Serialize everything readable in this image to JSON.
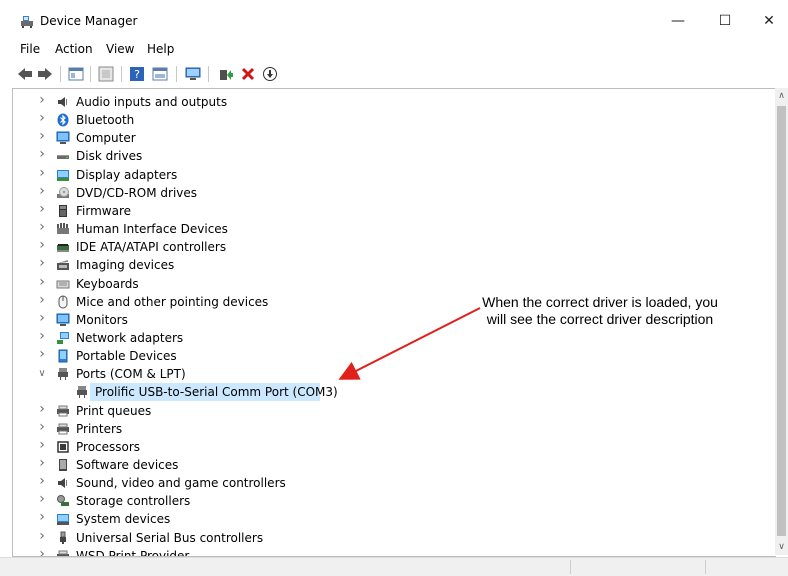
{
  "window": {
    "title": "Device Manager",
    "minimize_glyph": "—",
    "maximize_glyph": "☐",
    "close_glyph": "✕"
  },
  "menu": [
    "File",
    "Action",
    "View",
    "Help"
  ],
  "toolbar_icons": [
    "back-icon",
    "forward-icon",
    "properties-icon",
    "show-hidden-icon",
    "help-icon",
    "view-icon",
    "scan-hardware-icon",
    "update-driver-icon",
    "uninstall-icon",
    "disable-device-icon"
  ],
  "tree": {
    "nodes": [
      {
        "label": "Audio inputs and outputs",
        "icon": "speaker-icon",
        "expanded": false
      },
      {
        "label": "Bluetooth",
        "icon": "bluetooth-icon",
        "expanded": false
      },
      {
        "label": "Computer",
        "icon": "monitor-icon",
        "expanded": false
      },
      {
        "label": "Disk drives",
        "icon": "disk-drive-icon",
        "expanded": false
      },
      {
        "label": "Display adapters",
        "icon": "display-adapter-icon",
        "expanded": false
      },
      {
        "label": "DVD/CD-ROM drives",
        "icon": "dvd-drive-icon",
        "expanded": false
      },
      {
        "label": "Firmware",
        "icon": "firmware-icon",
        "expanded": false
      },
      {
        "label": "Human Interface Devices",
        "icon": "hid-icon",
        "expanded": false
      },
      {
        "label": "IDE ATA/ATAPI controllers",
        "icon": "ide-controller-icon",
        "expanded": false
      },
      {
        "label": "Imaging devices",
        "icon": "camera-icon",
        "expanded": false
      },
      {
        "label": "Keyboards",
        "icon": "keyboard-icon",
        "expanded": false
      },
      {
        "label": "Mice and other pointing devices",
        "icon": "mouse-icon",
        "expanded": false
      },
      {
        "label": "Monitors",
        "icon": "monitor-icon",
        "expanded": false
      },
      {
        "label": "Network adapters",
        "icon": "network-adapter-icon",
        "expanded": false
      },
      {
        "label": "Portable Devices",
        "icon": "portable-device-icon",
        "expanded": false
      },
      {
        "label": "Ports (COM & LPT)",
        "icon": "port-icon",
        "expanded": true
      },
      {
        "label": "Prolific USB-to-Serial Comm Port (COM3)",
        "icon": "port-icon",
        "child": true,
        "selected": true
      },
      {
        "label": "Print queues",
        "icon": "printer-icon",
        "expanded": false
      },
      {
        "label": "Printers",
        "icon": "printer-icon",
        "expanded": false
      },
      {
        "label": "Processors",
        "icon": "processor-icon",
        "expanded": false
      },
      {
        "label": "Software devices",
        "icon": "software-device-icon",
        "expanded": false
      },
      {
        "label": "Sound, video and game controllers",
        "icon": "speaker-icon",
        "expanded": false
      },
      {
        "label": "Storage controllers",
        "icon": "storage-controller-icon",
        "expanded": false
      },
      {
        "label": "System devices",
        "icon": "system-device-icon",
        "expanded": false
      },
      {
        "label": "Universal Serial Bus controllers",
        "icon": "usb-icon",
        "expanded": false
      },
      {
        "label": "WSD Print Provider",
        "icon": "printer-icon",
        "expanded": false
      }
    ]
  },
  "annotation": {
    "line1": "When the correct driver is loaded, you",
    "line2": "will see the correct driver description",
    "arrow_color": "#e0201b"
  },
  "colors": {
    "selection": "#cce8ff",
    "accent": "#0078d7"
  }
}
